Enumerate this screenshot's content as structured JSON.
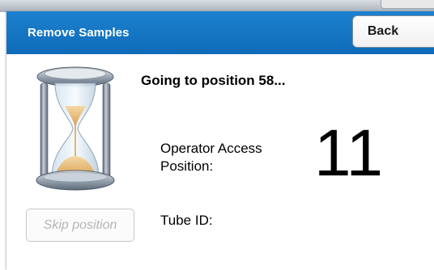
{
  "dialog": {
    "title": "Remove Samples",
    "back_label": "Back"
  },
  "status": {
    "message": "Going to position 58..."
  },
  "operator_access": {
    "label": "Operator Access Position:",
    "value": "11"
  },
  "skip_button": {
    "label": "Skip position"
  },
  "tube": {
    "label": "Tube ID:",
    "value": ""
  },
  "icons": {
    "hourglass": "hourglass-icon"
  },
  "colors": {
    "titlebar": "#1976c8",
    "title_text": "#ffffff",
    "disabled_text": "#b4b4b4"
  }
}
